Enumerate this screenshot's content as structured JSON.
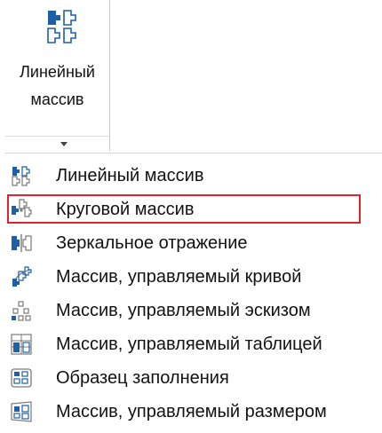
{
  "ribbon_button": {
    "label_line1": "Линейный",
    "label_line2": "массив",
    "icon": "linear-pattern-icon"
  },
  "dropdown": {
    "icon": "chevron-down-icon"
  },
  "menu": {
    "items": [
      {
        "label": "Линейный массив",
        "icon": "linear-pattern-icon"
      },
      {
        "label": "Круговой массив",
        "icon": "circular-pattern-icon",
        "highlighted": true
      },
      {
        "label": "Зеркальное отражение",
        "icon": "mirror-icon"
      },
      {
        "label": "Массив, управляемый кривой",
        "icon": "curve-driven-pattern-icon"
      },
      {
        "label": "Массив, управляемый эскизом",
        "icon": "sketch-driven-pattern-icon"
      },
      {
        "label": "Массив, управляемый таблицей",
        "icon": "table-driven-pattern-icon"
      },
      {
        "label": "Образец заполнения",
        "icon": "fill-pattern-icon"
      },
      {
        "label": " Массив, управляемый размером",
        "icon": "variable-pattern-icon"
      }
    ]
  },
  "colors": {
    "highlight_border": "#e0242e",
    "icon_blue": "#1f5fa8",
    "icon_gray": "#7a7a7a"
  }
}
